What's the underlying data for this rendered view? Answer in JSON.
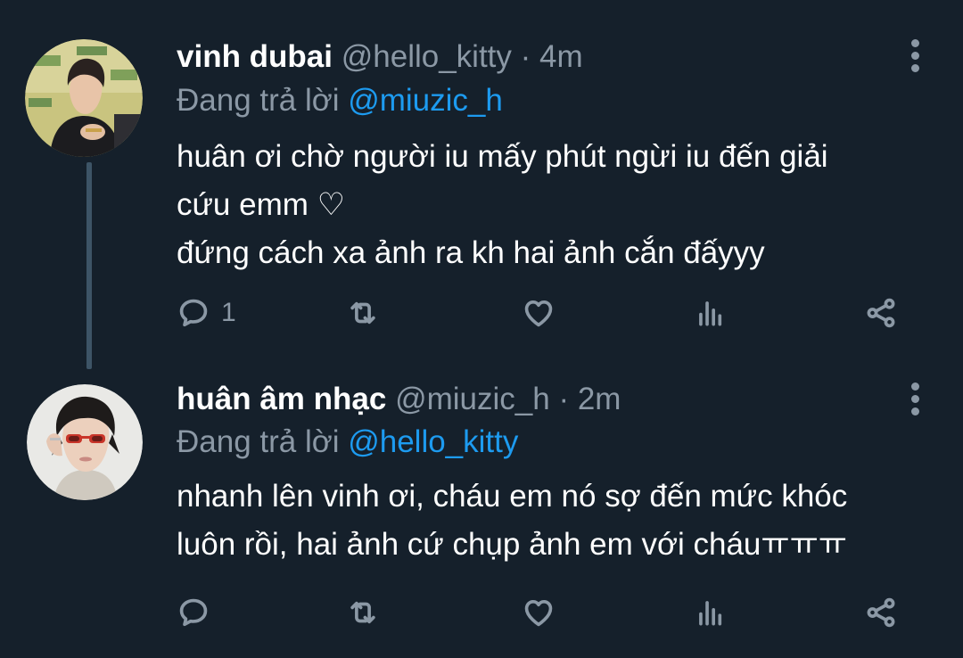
{
  "tweets": [
    {
      "name": "vinh dubai",
      "handle": "@hello_kitty",
      "separator": "·",
      "time": "4m",
      "replying_label": "Đang trả lời",
      "replying_to": "@miuzic_h",
      "text": "huân ơi chờ người iu mấy phút ngừi iu đến giải\ncứu emm ♡\nđứng cách xa ảnh ra kh hai ảnh cắn đấyyy",
      "reply_count": "1",
      "avatar_icon": "avatar-photo-icon"
    },
    {
      "name": "huân âm nhạc",
      "handle": "@miuzic_h",
      "separator": "·",
      "time": "2m",
      "replying_label": "Đang trả lời",
      "replying_to": "@hello_kitty",
      "text": "nhanh lên vinh ơi, cháu em nó sợ đến mức khóc\nluôn rồi, hai ảnh cứ chụp ảnh em với cháuㅠㅠㅠ",
      "reply_count": "",
      "avatar_icon": "avatar-photo-icon"
    }
  ],
  "colors": {
    "background": "#15202b",
    "text": "#ffffff",
    "secondary": "#8b98a5",
    "accent": "#1d9bf0",
    "thread_line": "#3d5466"
  },
  "icons": [
    "reply-icon",
    "retweet-icon",
    "like-icon",
    "views-icon",
    "share-icon",
    "more-options-icon"
  ]
}
